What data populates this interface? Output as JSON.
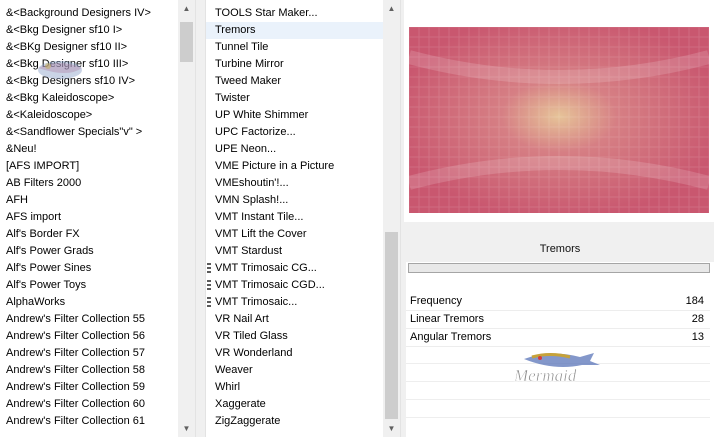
{
  "categories": {
    "items": [
      "&<Background Designers IV>",
      "&<Bkg Designer sf10 I>",
      "&<BKg Designer sf10 II>",
      "&<Bkg Designer sf10 III>",
      "&<Bkg Designers sf10 IV>",
      "&<Bkg Kaleidoscope>",
      "&<Kaleidoscope>",
      "&<Sandflower Specials\"v\" >",
      "&Neu!",
      "[AFS IMPORT]",
      "AB Filters 2000",
      "AFH",
      "AFS import",
      "Alf's Border FX",
      "Alf's Power Grads",
      "Alf's Power Sines",
      "Alf's Power Toys",
      "AlphaWorks",
      "Andrew's Filter Collection 55",
      "Andrew's Filter Collection 56",
      "Andrew's Filter Collection 57",
      "Andrew's Filter Collection 58",
      "Andrew's Filter Collection 59",
      "Andrew's Filter Collection 60",
      "Andrew's Filter Collection 61"
    ]
  },
  "filters": {
    "items": [
      "TOOLS Star Maker...",
      "Tremors",
      "Tunnel Tile",
      "Turbine Mirror",
      "Tweed Maker",
      "Twister",
      "UP White Shimmer",
      "UPC Factorize...",
      "UPE Neon...",
      "VME Picture in a Picture",
      "VMEshoutin'!...",
      "VMN Splash!...",
      "VMT Instant Tile...",
      "VMT Lift the Cover",
      "VMT Stardust",
      "VMT Trimosaic CG...",
      "VMT Trimosaic CGD...",
      "VMT Trimosaic...",
      "VR Nail Art",
      "VR Tiled Glass",
      "VR Wonderland",
      "Weaver",
      "Whirl",
      "Xaggerate",
      "ZigZaggerate"
    ],
    "selected_index": 1
  },
  "preview": {
    "colors": {
      "base": "#c9576f",
      "light": "#e6c398",
      "mid": "#d67f84"
    }
  },
  "properties": {
    "title": "Tremors",
    "rows": [
      {
        "label": "Frequency",
        "value": "184"
      },
      {
        "label": "Linear Tremors",
        "value": "28"
      },
      {
        "label": "Angular Tremors",
        "value": "13"
      }
    ]
  },
  "watermark": {
    "text": "Mermaid"
  }
}
